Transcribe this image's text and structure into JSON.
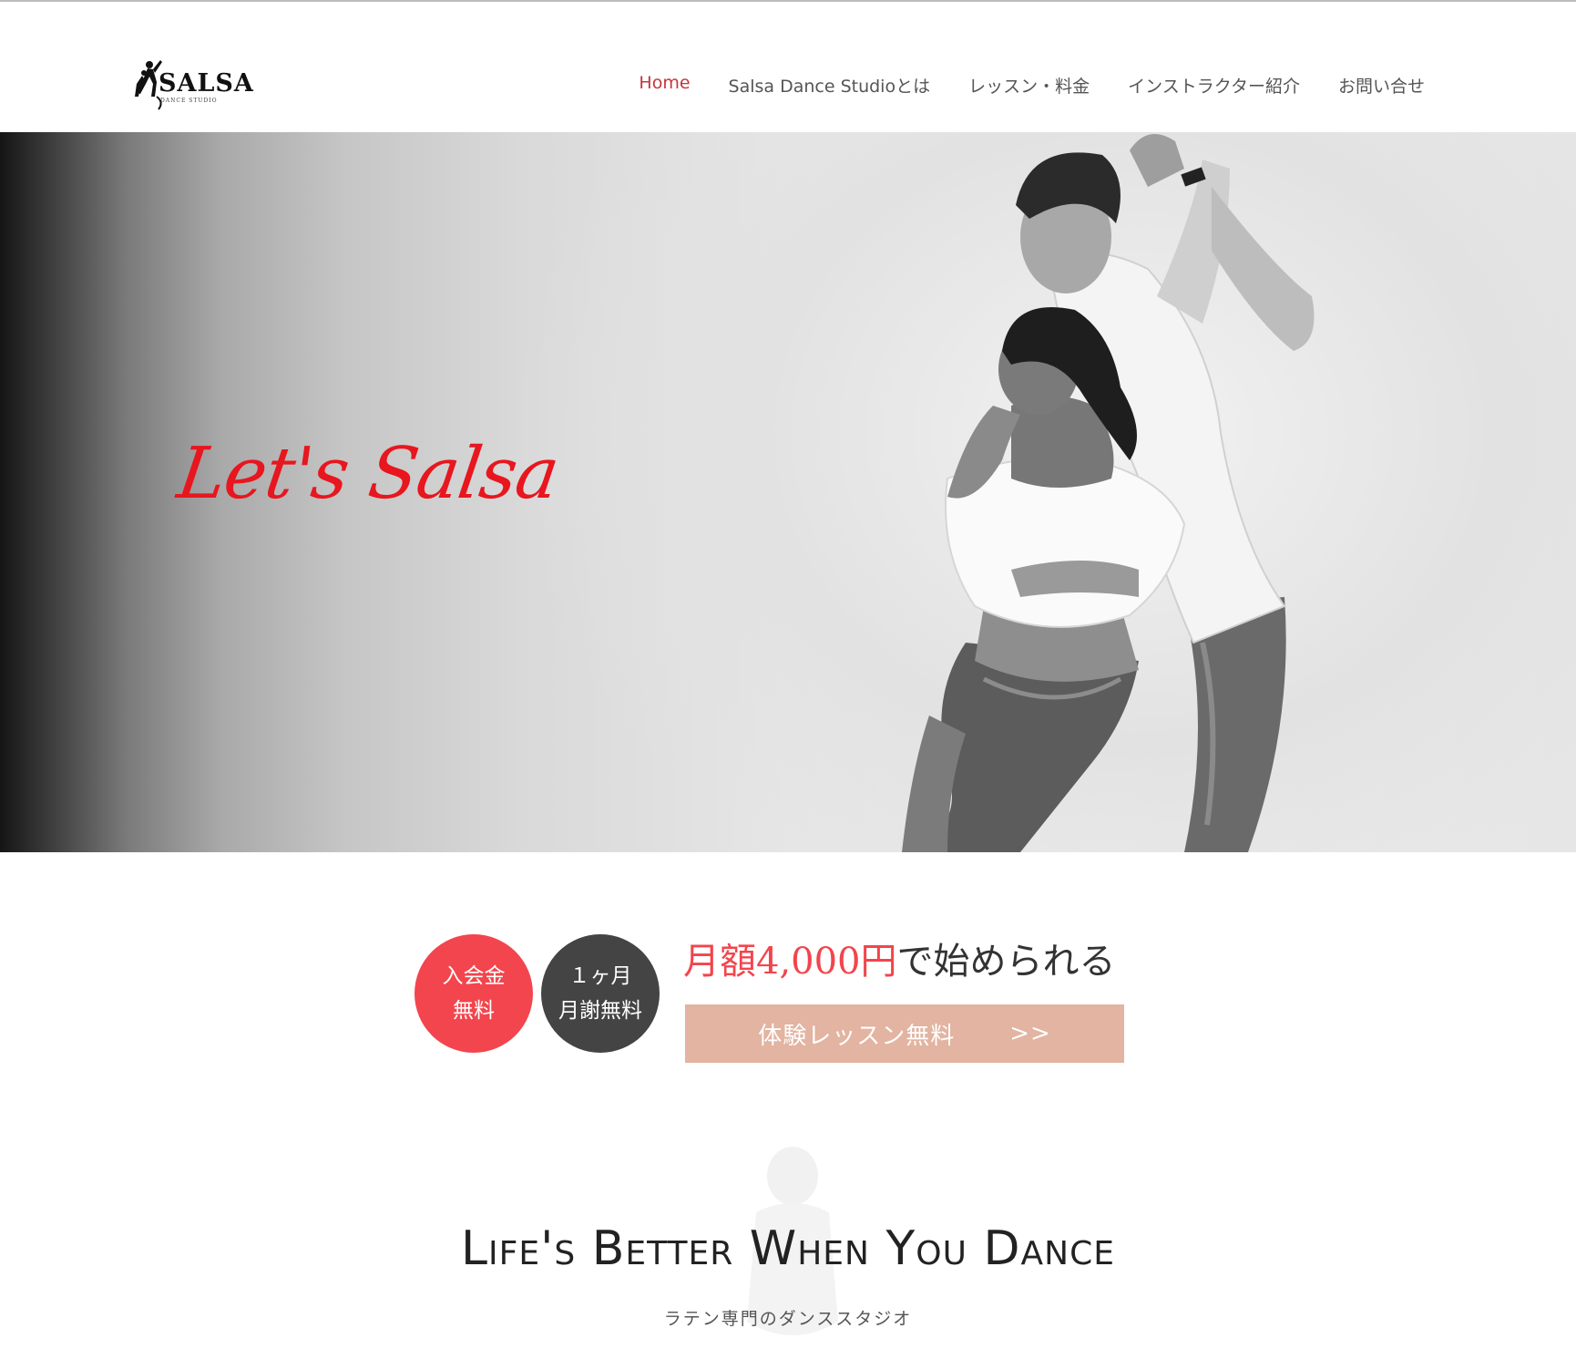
{
  "logo": {
    "word": "SALSA",
    "sub": "DANCE STUDIO"
  },
  "nav": {
    "items": [
      {
        "label": "Home"
      },
      {
        "label": "Salsa Dance Studioとは"
      },
      {
        "label": "レッスン・料金"
      },
      {
        "label": "インストラクター紹介"
      },
      {
        "label": "お問い合せ"
      }
    ]
  },
  "hero": {
    "title": "Let's Salsa"
  },
  "promo": {
    "badge1": {
      "line1": "入会金",
      "line2": "無料"
    },
    "badge2": {
      "line1": "１ヶ月",
      "line2": "月謝無料"
    },
    "heading_accent": "月額4,000円",
    "heading_rest": "で始められる",
    "cta_label": "体験レッスン無料",
    "cta_arrow": ">>"
  },
  "tagline": {
    "title": "Life's Better When You Dance",
    "subtitle": "ラテン専門のダンススタジオ"
  },
  "colors": {
    "accent_red": "#e8161e",
    "nav_active": "#c8343a",
    "badge_red": "#f2454d",
    "badge_dark": "#444444",
    "cta_bg": "#e2b4a1"
  }
}
